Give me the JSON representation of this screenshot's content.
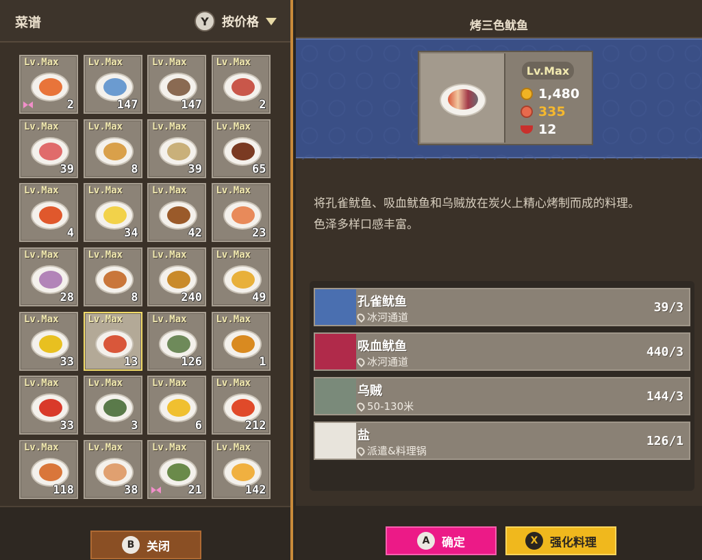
{
  "left": {
    "title": "菜谱",
    "sort_key": "Y",
    "sort_label": "按价格"
  },
  "grid": [
    {
      "lv": "Lv.Max",
      "count": "2",
      "food": "#e8743a",
      "ribbon": true
    },
    {
      "lv": "Lv.Max",
      "count": "147",
      "food": "#6b9bd0"
    },
    {
      "lv": "Lv.Max",
      "count": "147",
      "food": "#8a6a52"
    },
    {
      "lv": "Lv.Max",
      "count": "2",
      "food": "#c9574a"
    },
    {
      "lv": "Lv.Max",
      "count": "39",
      "food": "#e06b6b"
    },
    {
      "lv": "Lv.Max",
      "count": "8",
      "food": "#d9a04a"
    },
    {
      "lv": "Lv.Max",
      "count": "39",
      "food": "#c9b07a"
    },
    {
      "lv": "Lv.Max",
      "count": "65",
      "food": "#7a3a22"
    },
    {
      "lv": "Lv.Max",
      "count": "4",
      "food": "#e0582c"
    },
    {
      "lv": "Lv.Max",
      "count": "34",
      "food": "#f2d24a"
    },
    {
      "lv": "Lv.Max",
      "count": "42",
      "food": "#9a5a2a"
    },
    {
      "lv": "Lv.Max",
      "count": "23",
      "food": "#e88a5a"
    },
    {
      "lv": "Lv.Max",
      "count": "28",
      "food": "#b284b8"
    },
    {
      "lv": "Lv.Max",
      "count": "8",
      "food": "#c9763a"
    },
    {
      "lv": "Lv.Max",
      "count": "240",
      "food": "#c98a2a"
    },
    {
      "lv": "Lv.Max",
      "count": "49",
      "food": "#e8b03a"
    },
    {
      "lv": "Lv.Max",
      "count": "33",
      "food": "#e8c020"
    },
    {
      "lv": "Lv.Max",
      "count": "13",
      "food": "#d9573a",
      "selected": true
    },
    {
      "lv": "Lv.Max",
      "count": "126",
      "food": "#6e8a5a"
    },
    {
      "lv": "Lv.Max",
      "count": "1",
      "food": "#d98a20"
    },
    {
      "lv": "Lv.Max",
      "count": "33",
      "food": "#d93a2a"
    },
    {
      "lv": "Lv.Max",
      "count": "3",
      "food": "#5a7a4a"
    },
    {
      "lv": "Lv.Max",
      "count": "6",
      "food": "#f0c030"
    },
    {
      "lv": "Lv.Max",
      "count": "212",
      "food": "#e04a2a"
    },
    {
      "lv": "Lv.Max",
      "count": "118",
      "food": "#d9763a"
    },
    {
      "lv": "Lv.Max",
      "count": "38",
      "food": "#e0a070"
    },
    {
      "lv": "Lv.Max",
      "count": "21",
      "food": "#6a8a4a",
      "ribbon": true
    },
    {
      "lv": "Lv.Max",
      "count": "142",
      "food": "#f0b040"
    }
  ],
  "left_footer": {
    "close_key": "B",
    "close_label": "关闭"
  },
  "detail": {
    "title": "烤三色鱿鱼",
    "lv": "Lv.Max",
    "price": "1,480",
    "taste": "335",
    "count": "12",
    "colors": {
      "price": "#ffffff",
      "taste": "#f5b82e",
      "count": "#ffffff"
    },
    "description_line1": "将孔雀鱿鱼、吸血鱿鱼和乌贼放在炭火上精心烤制而成的料理。",
    "description_line2": "色泽多样口感丰富。"
  },
  "ingredients": [
    {
      "name": "孔雀鱿鱼",
      "location": "冰河通道",
      "qty": "39/3",
      "thumb": "#4a6fb0",
      "icon": "peacock-squid-icon"
    },
    {
      "name": "吸血鱿鱼",
      "location": "冰河通道",
      "qty": "440/3",
      "thumb": "#b02a4a",
      "icon": "vampire-squid-icon"
    },
    {
      "name": "乌贼",
      "location": "50-130米",
      "qty": "144/3",
      "thumb": "#7a8a7a",
      "icon": "cuttlefish-icon"
    },
    {
      "name": "盐",
      "location": "派遣&料理锅",
      "qty": "126/1",
      "thumb": "#e8e4dc",
      "icon": "salt-shaker-icon"
    }
  ],
  "right_footer": {
    "confirm_key": "A",
    "confirm_label": "确定",
    "enhance_key": "X",
    "enhance_label": "强化料理"
  }
}
